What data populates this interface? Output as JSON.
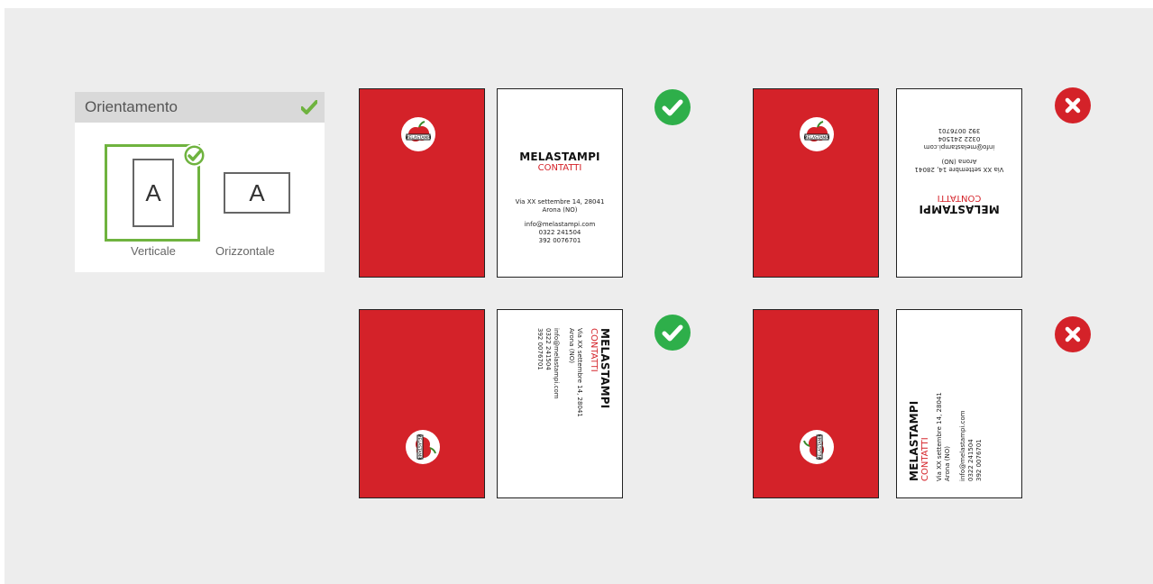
{
  "panel": {
    "title": "Orientamento",
    "options": [
      {
        "label": "Verticale",
        "glyph": "A",
        "selected": true
      },
      {
        "label": "Orizzontale",
        "glyph": "A",
        "selected": false
      }
    ]
  },
  "card_text": {
    "brand": "MELASTAMPI",
    "subtitle": "CONTATTI",
    "address_line1": "Via XX settembre 14, 28041",
    "address_line2": "Arona (NO)",
    "email": "info@melastampi.com",
    "phone1": "0322 241504",
    "phone2": "392 0076701",
    "logo_text": "MELASTAMPI"
  },
  "examples": [
    {
      "row": 1,
      "variant": "horizontal-text",
      "status": "correct"
    },
    {
      "row": 1,
      "variant": "upside-down-text",
      "status": "wrong"
    },
    {
      "row": 2,
      "variant": "rotated-clockwise",
      "status": "correct"
    },
    {
      "row": 2,
      "variant": "rotated-counterclockwise",
      "status": "wrong"
    }
  ],
  "colors": {
    "brand_red": "#d42229",
    "ok_green": "#2eaf4a",
    "select_green": "#6fb33f",
    "canvas": "#ededed"
  },
  "icons": [
    "check-icon",
    "check-circle-icon",
    "close-circle-icon",
    "apple-logo-icon",
    "page-icon"
  ]
}
